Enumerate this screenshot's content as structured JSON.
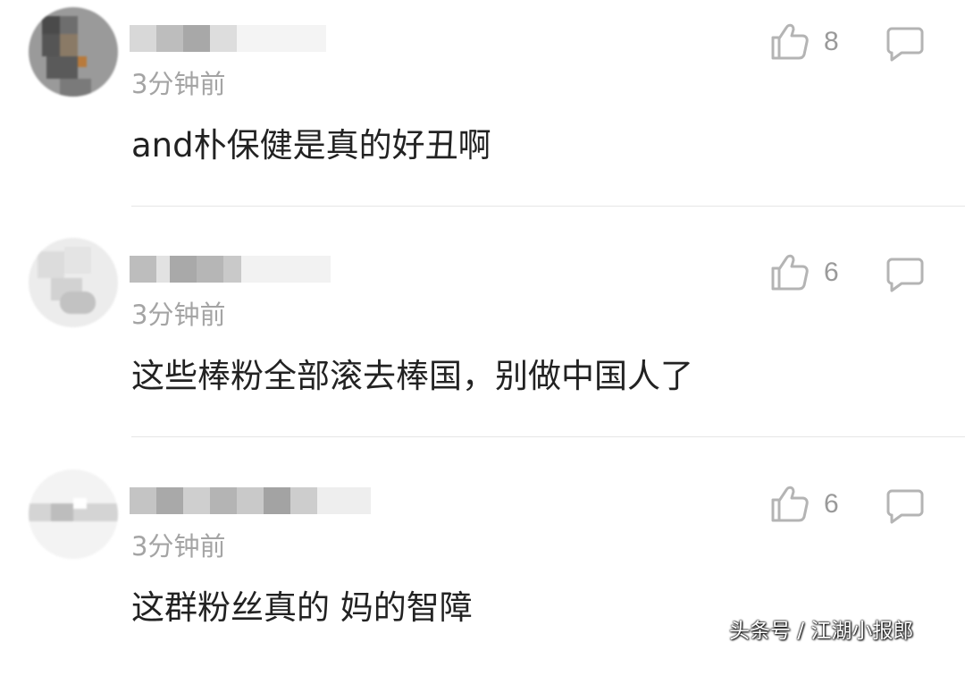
{
  "comments": [
    {
      "username": "",
      "time": "3分钟前",
      "text": "and朴保健是真的好丑啊",
      "likes": "8",
      "like_icon": "thumbs-up-icon",
      "reply_icon": "comment-bubble-icon"
    },
    {
      "username": "",
      "time": "3分钟前",
      "text": "这些棒粉全部滚去棒国，别做中国人了",
      "likes": "6",
      "like_icon": "thumbs-up-icon",
      "reply_icon": "comment-bubble-icon"
    },
    {
      "username": "",
      "time": "3分钟前",
      "text": "这群粉丝真的 妈的智障",
      "likes": "6",
      "like_icon": "thumbs-up-icon",
      "reply_icon": "comment-bubble-icon"
    }
  ],
  "watermark": "头条号 / 江湖小报郎",
  "colors": {
    "text": "#222222",
    "secondary": "#a4a4a4",
    "icon": "#b4b4b4",
    "divider": "#e6e6e6"
  }
}
